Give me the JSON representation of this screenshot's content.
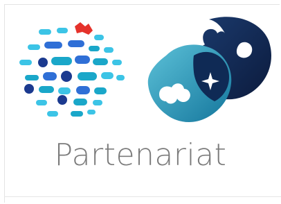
{
  "tile": {
    "caption": "Partenariat"
  },
  "logos": {
    "left": {
      "icon": "dot-network-logo-icon",
      "colors": {
        "light_blue": "#3cc4e6",
        "teal": "#1aa7c9",
        "navy": "#1b3a8f",
        "blue": "#2f6fd6",
        "red": "#e5322b"
      }
    },
    "right": {
      "icon": "puzzle-partnership-logo-icon",
      "colors": {
        "dark_navy": "#10254d",
        "teal": "#1c8eb2",
        "light_teal": "#5cc1d8",
        "white": "#ffffff"
      }
    }
  }
}
